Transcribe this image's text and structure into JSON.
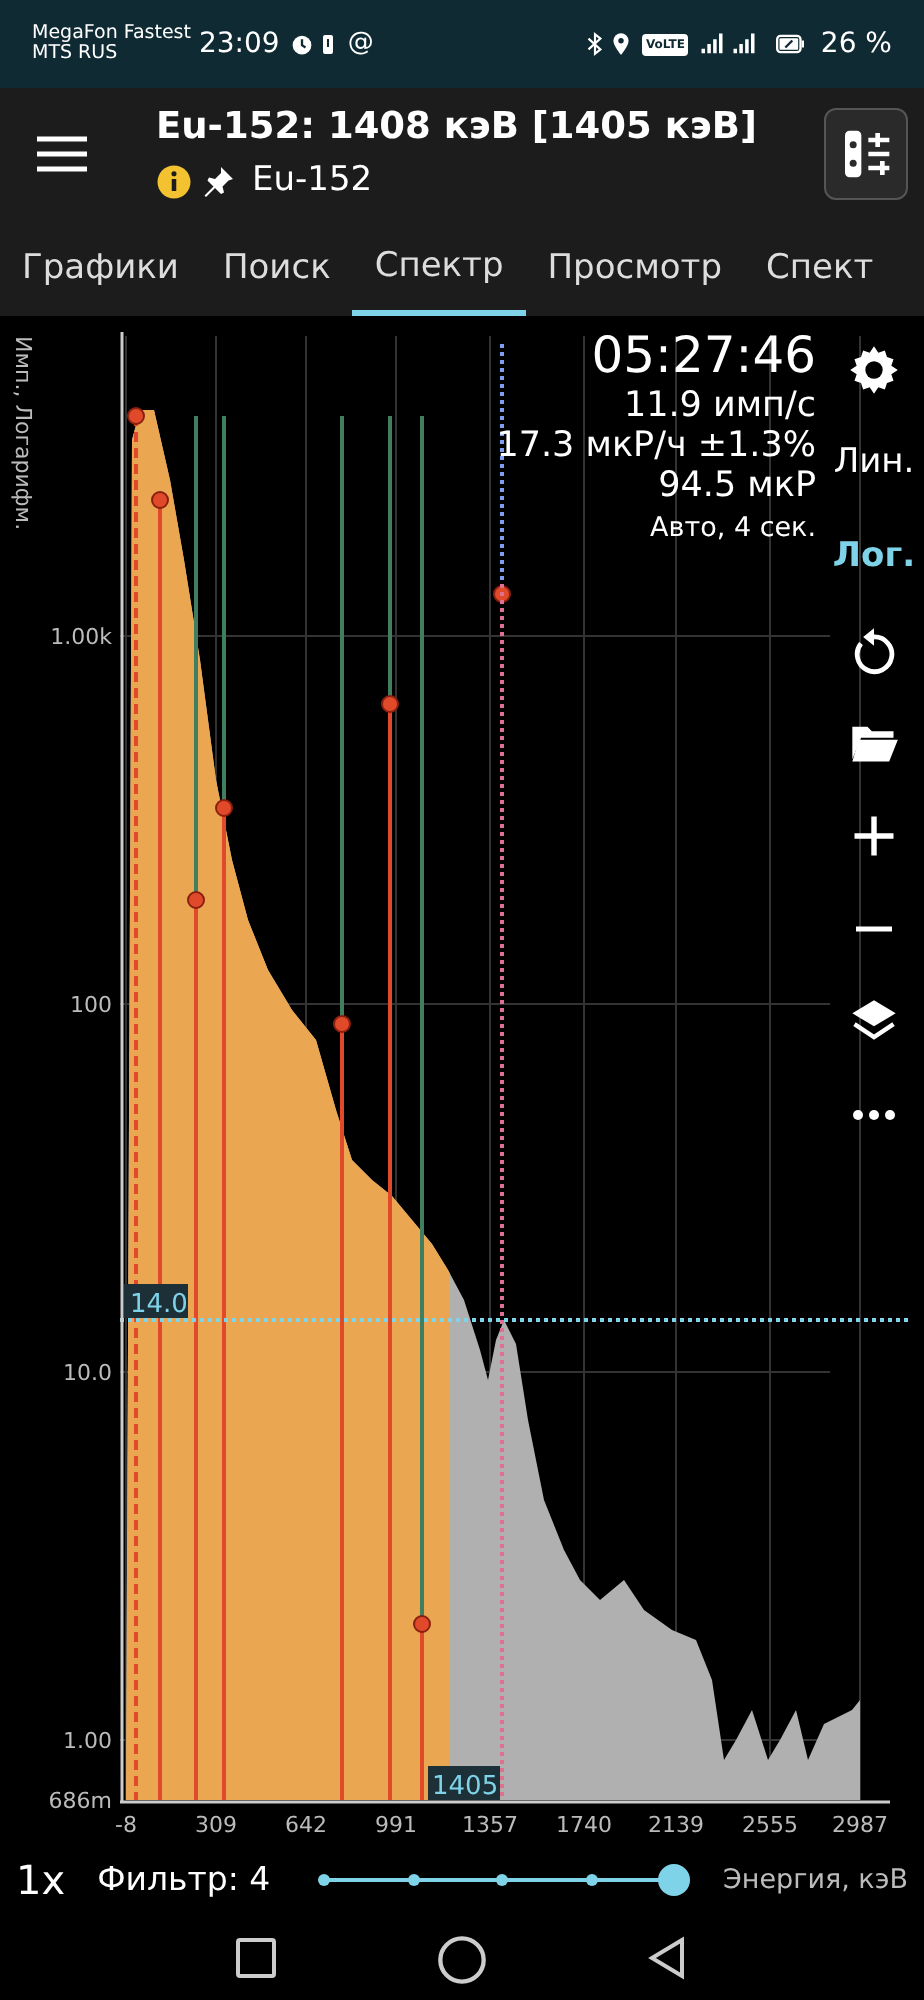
{
  "status_bar": {
    "carrier_1": "MegaFon Fastest",
    "carrier_2": "MTS RUS",
    "time": "23:09",
    "at_sign": "@",
    "volte": "VoLTE",
    "battery": "26 %"
  },
  "header": {
    "title": "Eu-152: 1408 кэВ [1405 кэВ]",
    "subtitle": "Eu-152"
  },
  "tabs": [
    {
      "label": "Графики",
      "selected": false
    },
    {
      "label": "Поиск",
      "selected": false
    },
    {
      "label": "Спектр",
      "selected": true
    },
    {
      "label": "Просмотр",
      "selected": false
    },
    {
      "label": "Спект",
      "selected": false
    }
  ],
  "spectrum": {
    "y_axis_label": "Имп., Логарифм.",
    "y_ticks": [
      "1.00k",
      "100",
      "10.0",
      "1.00",
      "686m"
    ],
    "x_ticks": [
      "-8",
      "309",
      "642",
      "991",
      "1357",
      "1740",
      "2139",
      "2555",
      "2987"
    ],
    "cursor_label": "14.0",
    "marker_label": "1405"
  },
  "readings": {
    "time": "05:27:46",
    "count_rate": "11.9 имп/с",
    "dose_rate": "17.3 мкР/ч ±1.3%",
    "dose": "94.5 мкР",
    "mode": "Авто, 4 сек."
  },
  "side_tools": [
    {
      "kind": "settings"
    },
    {
      "kind": "text",
      "label": "Лин.",
      "selected": false
    },
    {
      "kind": "text",
      "label": "Лог.",
      "selected": true
    },
    {
      "kind": "refresh"
    },
    {
      "kind": "folder"
    },
    {
      "kind": "plus"
    },
    {
      "kind": "minus"
    },
    {
      "kind": "layers"
    },
    {
      "kind": "more"
    }
  ],
  "bottom_bar": {
    "zoom": "1x",
    "filter": "Фильтр: 4",
    "filter_slider": {
      "level": 1.0
    },
    "axis_label": "Энергия, кэВ"
  }
}
